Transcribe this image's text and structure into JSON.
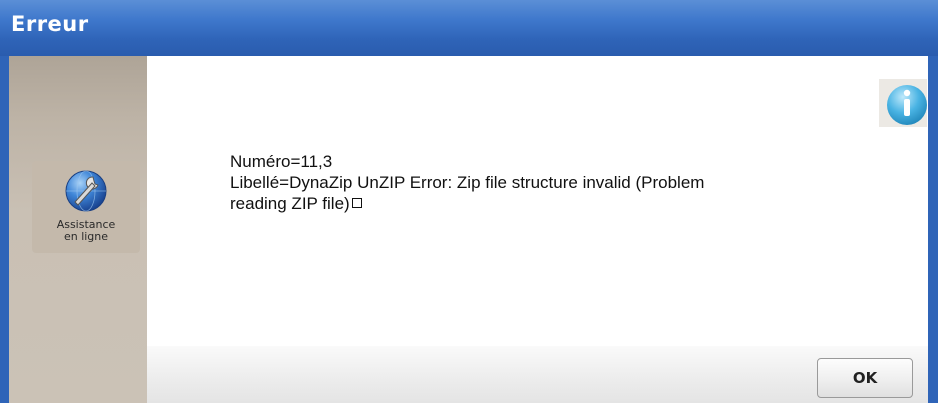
{
  "window": {
    "title": "Erreur"
  },
  "sidebar": {
    "help_button": {
      "label": "Assistance\nen ligne",
      "icon": "globe-wrench-icon"
    }
  },
  "message": {
    "line1": "Numéro=11,3",
    "line2": "Libellé=DynaZip UnZIP Error: Zip file structure invalid (Problem",
    "line3": "reading ZIP file)"
  },
  "info_icon": "info-icon",
  "buttons": {
    "ok_label": "OK"
  },
  "colors": {
    "titlebar": "#2f64b8",
    "sidebar": "#c9c0b4",
    "info_icon": "#3aa6d6"
  }
}
